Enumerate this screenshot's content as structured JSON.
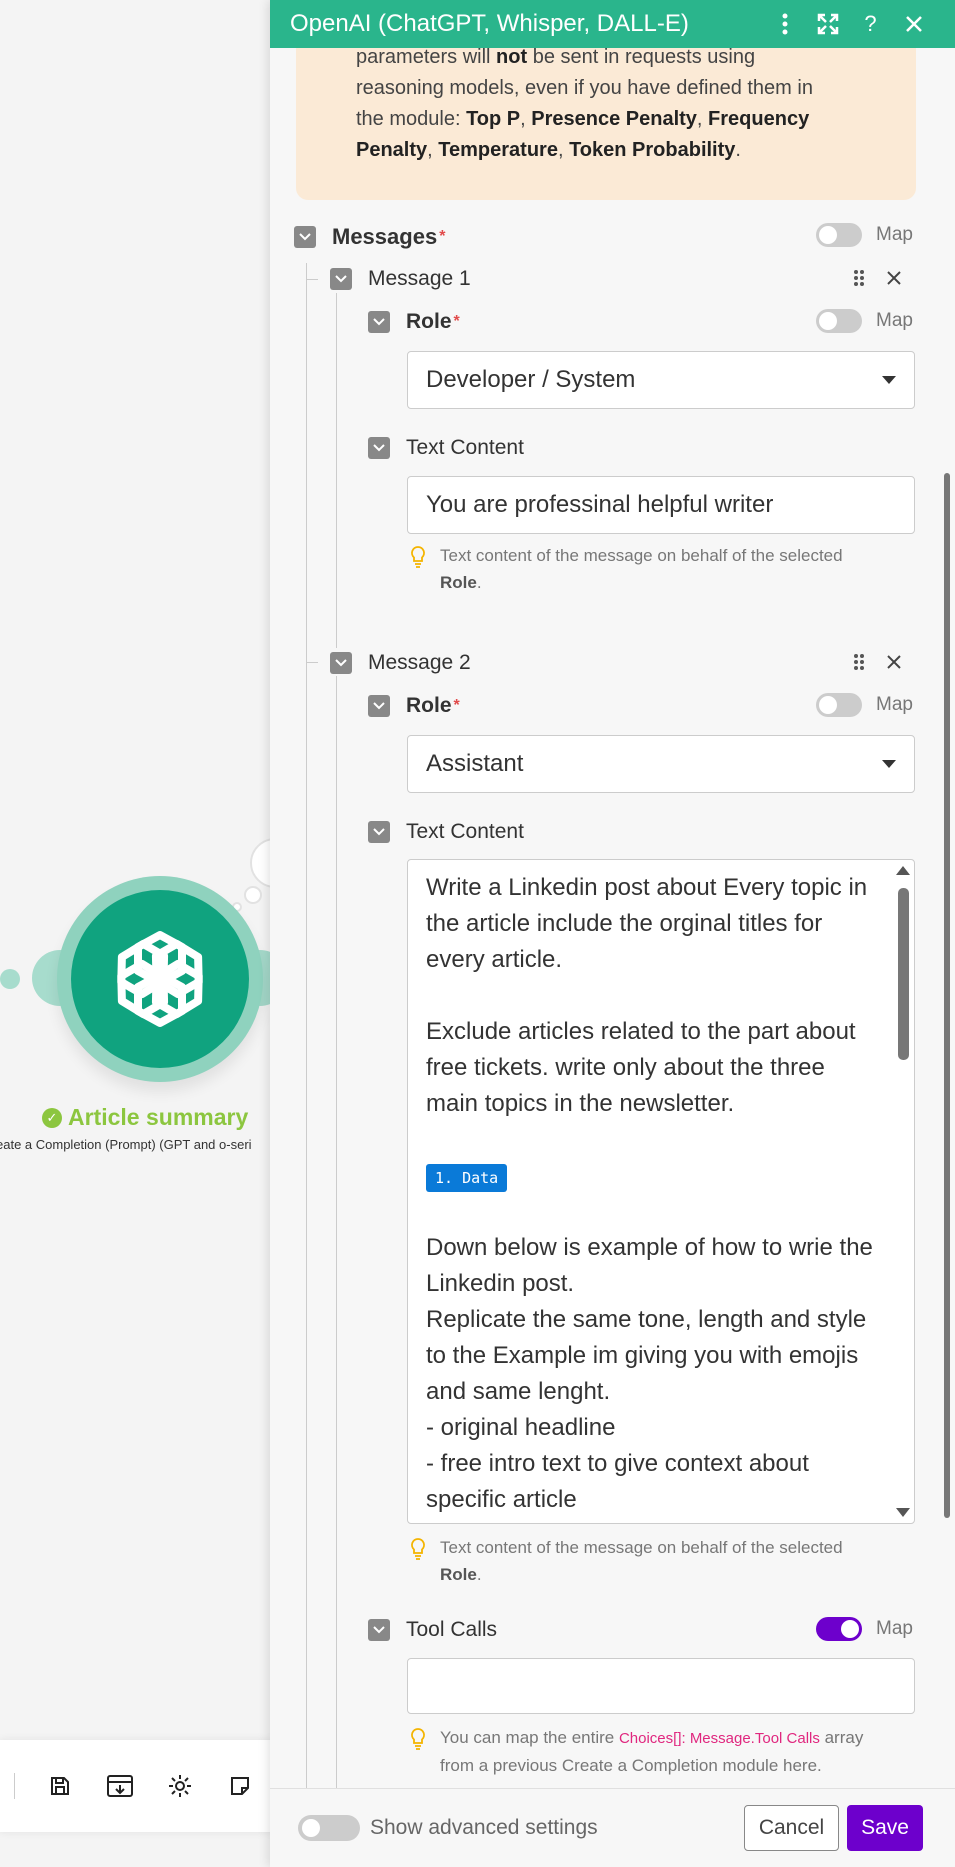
{
  "canvas": {
    "node": {
      "title": "Article summary",
      "subtitle": "eate a Completion (Prompt) (GPT and o-seri"
    },
    "toolbar_icons": [
      "save-icon",
      "export-icon",
      "settings-icon",
      "notes-icon"
    ]
  },
  "panel": {
    "title": "OpenAI (ChatGPT, Whisper, DALL-E)",
    "header_icons": [
      "more-vertical-icon",
      "expand-icon",
      "help-icon",
      "close-icon"
    ],
    "warning": {
      "line1_pre": "parameters will ",
      "line1_bold": "not",
      "line1_post": " be sent in requests using",
      "line2": "reasoning models, even if you have defined them in",
      "line3_pre": "the module: ",
      "p1": "Top P",
      "sep": ", ",
      "p2": "Presence Penalty",
      "p3a": "Frequency",
      "p3b": "Penalty",
      "p4": "Temperature",
      "p5": "Token Probability",
      "end": "."
    },
    "messages": {
      "label": "Messages",
      "required": "*",
      "map_label": "Map"
    },
    "message1": {
      "label": "Message 1",
      "role_label": "Role",
      "role_required": "*",
      "role_map_label": "Map",
      "role_value": "Developer / System",
      "text_label": "Text Content",
      "text_value": "You are professinal helpful writer",
      "hint_pre": "Text content of the message on behalf of the selected",
      "hint_bold": "Role",
      "hint_end": "."
    },
    "message2": {
      "label": "Message 2",
      "role_label": "Role",
      "role_required": "*",
      "role_map_label": "Map",
      "role_value": "Assistant",
      "text_label": "Text Content",
      "text_p1": "Write a Linkedin post about Every topic in the article include the orginal titles for every article.",
      "text_p2": "Exclude articles related to the part about free tickets. write only about the three main topics in the newsletter.",
      "data_pill": "1. Data",
      "text_p3": "Down below is example of how to wrie the Linkedin post.",
      "text_p4": "Replicate the same tone, length and style to the Example im giving you with emojis and same lenght.",
      "text_p5": "- original headline",
      "text_p6": "- free intro text to give context about specific article",
      "hint_pre": "Text content of the message on behalf of the selected",
      "hint_bold": "Role",
      "hint_end": ".",
      "tool_calls_label": "Tool Calls",
      "tool_calls_map_label": "Map",
      "tool_calls_map_on": true,
      "tool_hint_pre": "You can map the entire ",
      "tool_hint_pill": "Choices[]: Message.Tool Calls",
      "tool_hint_mid": " array",
      "tool_hint_line2": "from a previous Create a Completion module here."
    },
    "footer": {
      "advanced_label": "Show advanced settings",
      "cancel_label": "Cancel",
      "save_label": "Save"
    }
  }
}
